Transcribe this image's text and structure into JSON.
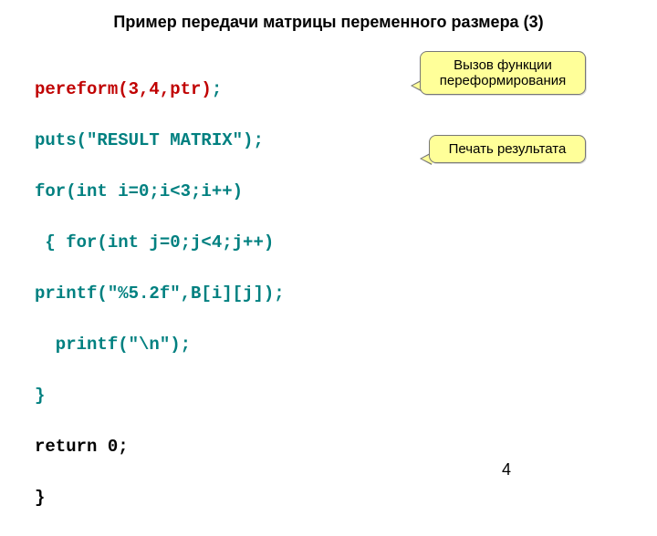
{
  "title": "Пример передачи матрицы переменного размера (3)",
  "code": {
    "l1a": "pereform(3,4,ptr)",
    "l1b": ";",
    "l2": "puts(\"RESULT MATRIX\");",
    "l3": "for(int i=0;i<3;i++)",
    "l4": " { for(int j=0;j<4;j++)",
    "l5": "printf(\"%5.2f\",B[i][j]);",
    "l6": "  printf(\"\\n\");",
    "l7": "}",
    "l8": "return 0;",
    "l9": "}"
  },
  "callouts": {
    "c1": "Вызов функции переформирования",
    "c2": "Печать результата"
  },
  "page": "4"
}
